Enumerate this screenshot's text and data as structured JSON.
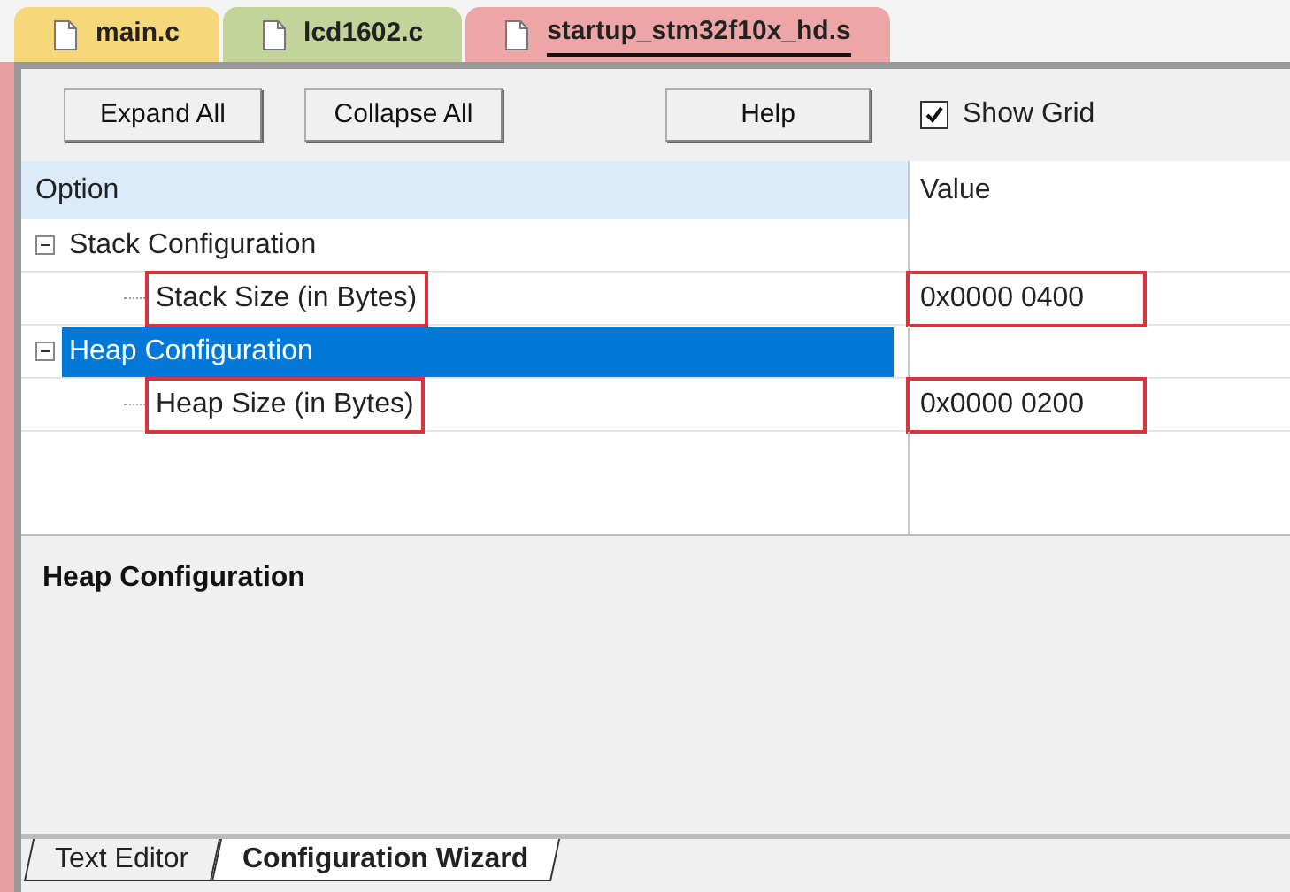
{
  "file_tabs": [
    {
      "label": "main.c",
      "color": "#f6d77a",
      "selected": false
    },
    {
      "label": "lcd1602.c",
      "color": "#c3d39a",
      "selected": false
    },
    {
      "label": "startup_stm32f10x_hd.s",
      "color": "#eda5a5",
      "selected": true
    }
  ],
  "toolbar": {
    "buttons": [
      "Expand All",
      "Collapse All",
      "Help"
    ],
    "show_grid": {
      "label": "Show Grid",
      "checked": true
    }
  },
  "grid": {
    "columns": [
      "Option",
      "Value"
    ],
    "tree": [
      {
        "label": "Stack Configuration",
        "expanded": true,
        "selected": false,
        "highlighted": false,
        "children": [
          {
            "label": "Stack Size (in Bytes)",
            "value": "0x0000 0400",
            "selected": false,
            "highlighted": true
          }
        ]
      },
      {
        "label": "Heap Configuration",
        "expanded": true,
        "selected": true,
        "highlighted": false,
        "children": [
          {
            "label": "Heap Size (in Bytes)",
            "value": "0x0000 0200",
            "selected": false,
            "highlighted": true
          }
        ]
      }
    ]
  },
  "description": {
    "title": "Heap Configuration"
  },
  "bottom_tabs": [
    {
      "label": "Text Editor",
      "selected": false
    },
    {
      "label": "Configuration Wizard",
      "selected": true
    }
  ]
}
